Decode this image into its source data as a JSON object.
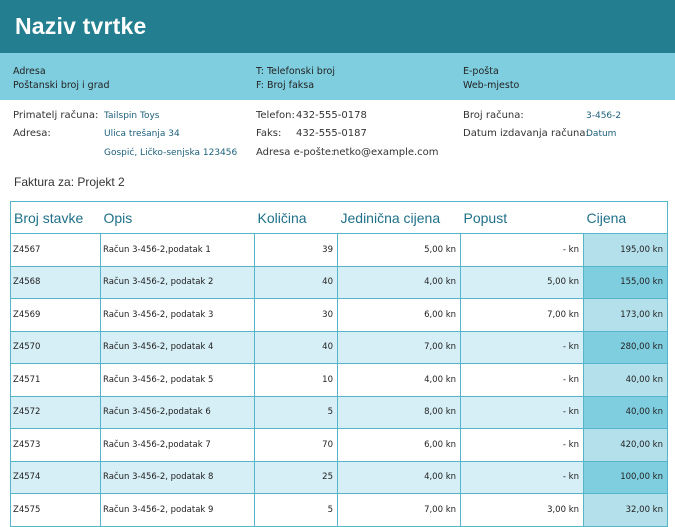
{
  "company": {
    "name": "Naziv tvrtke"
  },
  "contact_band": {
    "address": "Adresa",
    "postal_city": "Poštanski broj i grad",
    "phone": "T: Telefonski broj",
    "fax": "F: Broj faksa",
    "email": "E-pošta",
    "website": "Web-mjesto"
  },
  "recipient": {
    "label": "Primatelj računa:",
    "name": "Tailspin Toys",
    "address_label": "Adresa:",
    "street": "Ulica trešanja 34",
    "city": "Gospić, Ličko-senjska 123456"
  },
  "contact_details": {
    "phone_label": "Telefon:",
    "phone": "432-555-0178",
    "fax_label": "Faks:",
    "fax": "432-555-0187",
    "email_label": "Adresa e-pošte:",
    "email": "netko@example.com"
  },
  "invoice_meta": {
    "number_label": "Broj računa:",
    "number": "3-456-2",
    "date_label": "Datum izdavanja računa:",
    "date": "Datum"
  },
  "invoice_for": "Faktura za: Projekt 2",
  "table": {
    "columns": [
      "Broj stavke",
      "Opis",
      "Količina",
      "Jedinična cijena",
      "Popust",
      "Cijena"
    ],
    "rows": [
      {
        "item": "Z4567",
        "desc": "Račun 3-456-2,podatak 1",
        "qty": "39",
        "unit": "5,00 kn",
        "discount": "-    kn",
        "price": "195,00 kn"
      },
      {
        "item": "Z4568",
        "desc": "Račun 3-456-2, podatak 2",
        "qty": "40",
        "unit": "4,00 kn",
        "discount": "5,00 kn",
        "price": "155,00 kn"
      },
      {
        "item": "Z4569",
        "desc": "Račun 3-456-2, podatak 3",
        "qty": "30",
        "unit": "6,00 kn",
        "discount": "7,00 kn",
        "price": "173,00 kn"
      },
      {
        "item": "Z4570",
        "desc": "Račun 3-456-2, podatak 4",
        "qty": "40",
        "unit": "7,00 kn",
        "discount": "-    kn",
        "price": "280,00 kn"
      },
      {
        "item": "Z4571",
        "desc": "Račun 3-456-2, podatak 5",
        "qty": "10",
        "unit": "4,00 kn",
        "discount": "-    kn",
        "price": "40,00 kn"
      },
      {
        "item": "Z4572",
        "desc": "Račun 3-456-2,podatak 6",
        "qty": "5",
        "unit": "8,00 kn",
        "discount": "-    kn",
        "price": "40,00 kn"
      },
      {
        "item": "Z4573",
        "desc": "Račun 3-456-2,podatak 7",
        "qty": "70",
        "unit": "6,00 kn",
        "discount": "-    kn",
        "price": "420,00 kn"
      },
      {
        "item": "Z4574",
        "desc": "Račun 3-456-2, podatak 8",
        "qty": "25",
        "unit": "4,00 kn",
        "discount": "-    kn",
        "price": "100,00 kn"
      },
      {
        "item": "Z4575",
        "desc": "Račun 3-456-2, podatak 9",
        "qty": "5",
        "unit": "7,00 kn",
        "discount": "3,00 kn",
        "price": "32,00 kn"
      }
    ]
  },
  "colors": {
    "header_bg": "#237f90",
    "band_bg": "#7fcee0",
    "row_alt": "#d6eef5",
    "price_col": "#b4e0ec",
    "header_text": "#1f7088"
  }
}
